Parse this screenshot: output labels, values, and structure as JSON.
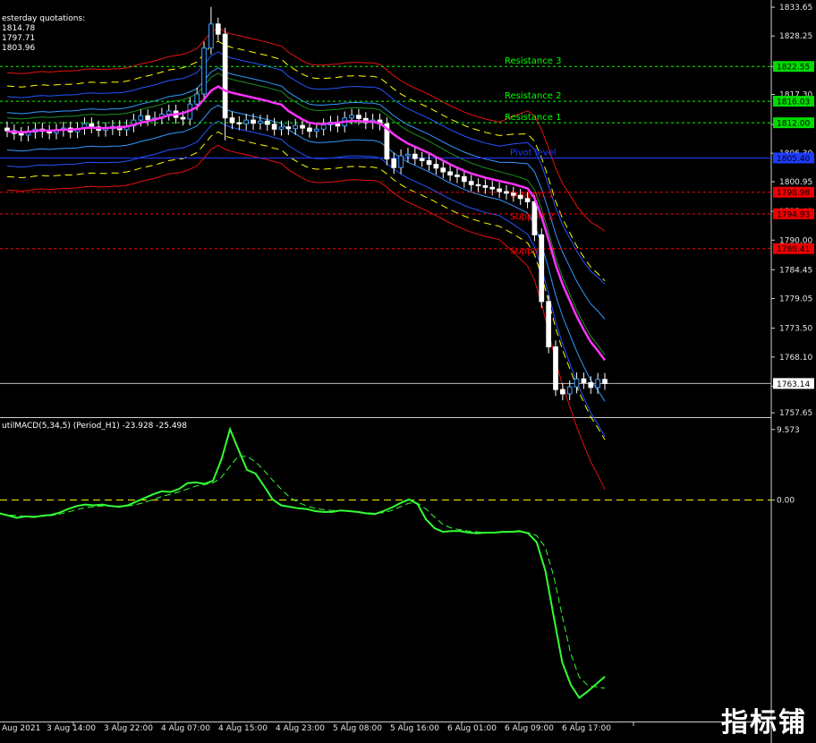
{
  "window": {
    "title_partial": "esterday quotations:",
    "quote_high": "1814.78",
    "quote_low": "1797.71",
    "quote_close": "1803.96",
    "macd_label": "utilMACD(5,34,5) (Period_H1) -23.928 -25.498",
    "watermark": "指标铺"
  },
  "chart_data": {
    "type": "line",
    "symbol_timeframe": "H1",
    "price_axis": {
      "ticks": [
        "1833.65",
        "1828.25",
        "1822.55",
        "1817.30",
        "1811.70",
        "1806.30",
        "1800.95",
        "1795.40",
        "1790.00",
        "1784.45",
        "1779.05",
        "1773.50",
        "1768.10",
        "1762.60",
        "1757.65"
      ],
      "range": [
        1757.0,
        1835.0
      ]
    },
    "x_ticks": [
      "Aug 2021",
      "3 Aug 14:00",
      "3 Aug 22:00",
      "4 Aug 07:00",
      "4 Aug 15:00",
      "4 Aug 23:00",
      "5 Aug 08:00",
      "5 Aug 16:00",
      "6 Aug 01:00",
      "6 Aug 09:00",
      "6 Aug 17:00"
    ],
    "levels": [
      {
        "name": "Resistance 3",
        "value": 1822.55,
        "color": "#00ff00",
        "label_color": "#00ff00",
        "tag": "1822.55"
      },
      {
        "name": "Resistance 2",
        "value": 1816.03,
        "color": "#00ff00",
        "label_color": "#00ff00",
        "tag": "1816.03"
      },
      {
        "name": "Resistance 1",
        "value": 1812.0,
        "color": "#00ff00",
        "label_color": "#00ff00",
        "tag": "1812.00"
      },
      {
        "name": "Pivot level",
        "value": 1805.4,
        "color": "#1e3cff",
        "label_color": "#1e3cff",
        "tag": "1805.40"
      },
      {
        "name": "Support 1",
        "value": 1798.98,
        "color": "#ff0000",
        "label_color": "#ff0000",
        "tag": "1798.98"
      },
      {
        "name": "Support 2",
        "value": 1794.93,
        "color": "#ff0000",
        "label_color": "#ff0000",
        "tag": "1794.93"
      },
      {
        "name": "Support 3",
        "value": 1788.41,
        "color": "#ff0000",
        "label_color": "#ff0000",
        "tag": "1788.41"
      }
    ],
    "current_price": {
      "value": 1763.14,
      "tag": "1763.14"
    },
    "candles_close": [
      1810.5,
      1810.0,
      1809.7,
      1810.2,
      1810.8,
      1810.4,
      1810.1,
      1810.6,
      1811.0,
      1810.3,
      1810.9,
      1811.8,
      1811.2,
      1810.6,
      1810.9,
      1811.3,
      1810.7,
      1811.4,
      1812.5,
      1813.3,
      1812.6,
      1812.9,
      1813.6,
      1814.2,
      1813.0,
      1812.7,
      1815.5,
      1817.4,
      1826.0,
      1830.5,
      1828.6,
      1812.9,
      1812.0,
      1811.8,
      1812.5,
      1811.9,
      1812.3,
      1811.7,
      1810.8,
      1811.2,
      1810.9,
      1811.5,
      1811.0,
      1810.4,
      1810.8,
      1811.6,
      1812.1,
      1811.4,
      1812.9,
      1813.4,
      1812.8,
      1812.0,
      1812.5,
      1811.8,
      1805.2,
      1803.6,
      1805.8,
      1806.1,
      1805.3,
      1804.9,
      1804.2,
      1803.5,
      1802.8,
      1802.2,
      1801.9,
      1801.0,
      1800.4,
      1800.2,
      1799.9,
      1799.6,
      1799.1,
      1798.8,
      1798.4,
      1797.8,
      1797.2,
      1791.0,
      1778.5,
      1770.0,
      1762.0,
      1761.2,
      1762.5,
      1764.0,
      1763.3,
      1762.4,
      1763.9,
      1763.14
    ],
    "series": [
      {
        "name": "MA",
        "color": "#ff33ff"
      },
      {
        "name": "Bands outer",
        "color": "#e81010"
      },
      {
        "name": "Bands middle",
        "color": "#2255ff"
      },
      {
        "name": "Bands inner",
        "color": "#3399ff"
      },
      {
        "name": "Trend",
        "color": "#ffff00"
      },
      {
        "name": "Slow MA",
        "color": "#1f8f1f"
      }
    ],
    "ma": [
      1810.4,
      1810.3,
      1810.2,
      1810.3,
      1810.5,
      1810.6,
      1810.5,
      1810.6,
      1810.7,
      1810.7,
      1810.8,
      1811.0,
      1811.1,
      1811.0,
      1811.0,
      1811.1,
      1811.1,
      1811.3,
      1811.6,
      1812.0,
      1812.3,
      1812.6,
      1813.0,
      1813.4,
      1813.6,
      1813.8,
      1814.3,
      1814.9,
      1816.4,
      1818.0,
      1818.8,
      1818.0,
      1817.6,
      1817.3,
      1817.0,
      1816.7,
      1816.4,
      1816.1,
      1815.7,
      1815.4,
      1814.2,
      1813.4,
      1812.6,
      1812.0,
      1811.8,
      1811.8,
      1811.9,
      1812.0,
      1812.2,
      1812.3,
      1812.3,
      1812.2,
      1812.2,
      1811.9,
      1810.9,
      1809.8,
      1808.9,
      1808.1,
      1807.5,
      1806.9,
      1806.3,
      1805.6,
      1804.9,
      1804.2,
      1803.6,
      1803.0,
      1802.5,
      1802.1,
      1801.7,
      1801.4,
      1801.1,
      1800.8,
      1800.5,
      1800.1,
      1799.7,
      1797.9,
      1794.4,
      1790.1,
      1785.4,
      1781.7,
      1778.7,
      1775.7,
      1773.2,
      1770.9,
      1769.3,
      1767.5
    ],
    "macd": {
      "label": "utilMACD(5,34,5) (Period_H1) -23.928 -25.498",
      "axis_ticks": [
        "9.573",
        "0.00"
      ],
      "range": [
        -30.0,
        11.0
      ],
      "main": [
        -1.8,
        -2.1,
        -2.4,
        -2.2,
        -2.3,
        -2.1,
        -2.0,
        -1.7,
        -1.2,
        -0.8,
        -0.6,
        -0.7,
        -0.6,
        -0.8,
        -0.9,
        -0.7,
        -0.2,
        0.3,
        0.8,
        1.2,
        1.1,
        1.5,
        2.3,
        2.4,
        2.2,
        2.6,
        5.5,
        9.6,
        6.8,
        4.1,
        3.6,
        1.9,
        0.1,
        -0.7,
        -0.9,
        -1.1,
        -1.2,
        -1.5,
        -1.6,
        -1.6,
        -1.4,
        -1.5,
        -1.6,
        -1.8,
        -1.9,
        -1.5,
        -1.0,
        -0.4,
        0.1,
        -0.5,
        -2.6,
        -3.8,
        -4.3,
        -4.2,
        -4.2,
        -4.4,
        -4.5,
        -4.4,
        -4.4,
        -4.3,
        -4.3,
        -4.2,
        -4.5,
        -5.7,
        -9.5,
        -15.8,
        -22.0,
        -25.0,
        -26.8,
        -25.9,
        -24.9,
        -23.928
      ],
      "signal": [
        -1.9,
        -2.0,
        -2.1,
        -2.2,
        -2.2,
        -2.2,
        -2.1,
        -1.9,
        -1.6,
        -1.3,
        -1.0,
        -0.9,
        -0.8,
        -0.8,
        -0.8,
        -0.8,
        -0.6,
        -0.3,
        0.1,
        0.5,
        0.8,
        1.1,
        1.5,
        1.9,
        2.1,
        2.3,
        3.1,
        4.6,
        6.0,
        5.9,
        5.2,
        4.0,
        2.7,
        1.5,
        0.4,
        -0.3,
        -0.8,
        -1.1,
        -1.3,
        -1.4,
        -1.4,
        -1.5,
        -1.6,
        -1.7,
        -1.8,
        -1.7,
        -1.4,
        -0.9,
        -0.4,
        -0.4,
        -1.2,
        -2.3,
        -3.3,
        -3.8,
        -4.0,
        -4.2,
        -4.3,
        -4.4,
        -4.4,
        -4.4,
        -4.3,
        -4.3,
        -4.4,
        -4.8,
        -6.4,
        -10.3,
        -15.7,
        -20.8,
        -24.0,
        -25.1,
        -25.3,
        -25.498
      ]
    }
  }
}
